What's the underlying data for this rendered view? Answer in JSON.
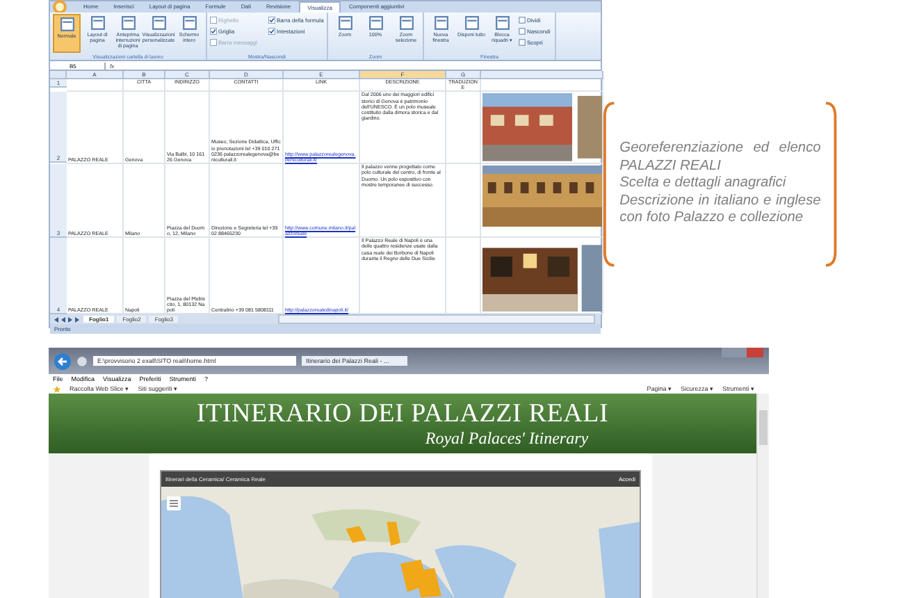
{
  "excel": {
    "tabs": [
      {
        "label": "Home",
        "selected": false
      },
      {
        "label": "Inserisci",
        "selected": false
      },
      {
        "label": "Layout di pagina",
        "selected": false
      },
      {
        "label": "Formule",
        "selected": false
      },
      {
        "label": "Dati",
        "selected": false
      },
      {
        "label": "Revisione",
        "selected": false
      },
      {
        "label": "Visualizza",
        "selected": true
      },
      {
        "label": "Componenti aggiuntivi",
        "selected": false
      }
    ],
    "ribbon_groups": [
      {
        "label": "Visualizzazioni cartella di lavoro",
        "items": [
          {
            "kind": "button",
            "label": "Normale",
            "selected": true
          },
          {
            "kind": "button",
            "label": "Layout di pagina",
            "selected": false
          },
          {
            "kind": "button",
            "label": "Anteprima interruzioni di pagina",
            "selected": false
          },
          {
            "kind": "button",
            "label": "Visualizzazioni personalizzate",
            "selected": false
          },
          {
            "kind": "button",
            "label": "Schermo intero",
            "selected": false
          }
        ]
      },
      {
        "label": "Mostra/Nascondi",
        "items": [
          {
            "kind": "check",
            "label": "Righello",
            "checked": false,
            "disabled": true
          },
          {
            "kind": "check",
            "label": "Griglia",
            "checked": true,
            "disabled": false
          },
          {
            "kind": "check",
            "label": "Barra messaggi",
            "checked": false,
            "disabled": true
          },
          {
            "kind": "check",
            "label": "Barra della formula",
            "checked": true,
            "disabled": false
          },
          {
            "kind": "check",
            "label": "Intestazioni",
            "checked": true,
            "disabled": false
          }
        ]
      },
      {
        "label": "Zoom",
        "items": [
          {
            "kind": "button",
            "label": "Zoom",
            "selected": false
          },
          {
            "kind": "button",
            "label": "100%",
            "selected": false
          },
          {
            "kind": "button",
            "label": "Zoom selezione",
            "selected": false
          }
        ]
      },
      {
        "label": "Finestra",
        "items": [
          {
            "kind": "button",
            "label": "Nuova finestra",
            "selected": false
          },
          {
            "kind": "button",
            "label": "Disponi tutto",
            "selected": false
          },
          {
            "kind": "button",
            "label": "Blocca riquadri ▾",
            "selected": false
          },
          {
            "kind": "small",
            "label": "Dividi"
          },
          {
            "kind": "small",
            "label": "Nascondi"
          },
          {
            "kind": "small",
            "label": "Scopri"
          }
        ]
      }
    ],
    "name_box": "B5",
    "formula_label": "fx",
    "columns": [
      {
        "label": "A",
        "selected": false
      },
      {
        "label": "B",
        "selected": false
      },
      {
        "label": "C",
        "selected": false
      },
      {
        "label": "D",
        "selected": false
      },
      {
        "label": "E",
        "selected": false
      },
      {
        "label": "F",
        "selected": true
      },
      {
        "label": "G",
        "selected": false
      }
    ],
    "header_row": {
      "number": "1",
      "cells": [
        "CITTA",
        "INDIRIZZO",
        "CONTATTI",
        "LINK",
        "DESCRIZIONE",
        "TRADUZIONE"
      ]
    },
    "rows": [
      {
        "number": "2",
        "name": "PALAZZO REALE",
        "city": "Genova",
        "address": "Via Balbi, 10 16126 Genova",
        "contacts": "Museo, Sezione Didattica, Ufficio prenotazioni tel +39 010 2710236 palazzorealegenova@beniculturali.it",
        "link": "http://www.palazzorealegenova.beniculturali.it/",
        "description": "Dal 2006 uno dei maggiori edifici storici di Genova è patrimonio dell'UNESCO. È un polo museale costituito dalla dimora storica e dal giardino."
      },
      {
        "number": "3",
        "name": "PALAZZO REALE",
        "city": "Milano",
        "address": "Piazza del Duomo, 12, Milano",
        "contacts": "Direzione e Segreteria tel +39 02 88465230",
        "link": "http://www.comune.milano.it/palazzoreale",
        "description": "Il palazzo venne progettato come polo culturale del centro, di fronte al Duomo. Un polo espositivo con mostre temporanee di successo."
      },
      {
        "number": "4",
        "name": "PALAZZO REALE",
        "city": "Napoli",
        "address": "Piazza del Plebiscito, 1, 80132 Napoli",
        "contacts": "Centralino +39 081 5808111",
        "link": "http://palazzorealedinapoli.it/",
        "description": "Il Palazzo Reale di Napoli è una delle quattro residenze usate dalla casa reale dei Borbone di Napoli durante il Regno delle Due Sicilie"
      }
    ],
    "sheet_tabs": [
      {
        "label": "Foglio1",
        "selected": true
      },
      {
        "label": "Foglio2",
        "selected": false
      },
      {
        "label": "Foglio3",
        "selected": false
      }
    ],
    "status": "Pronto"
  },
  "annotation": {
    "paragraphs": [
      "Georeferenziazione ed elenco PALAZZI REALI",
      "Scelta e dettagli anagrafici",
      "Descrizione in italiano e inglese con foto Palazzo e collezione"
    ]
  },
  "browser": {
    "address": "E:\\provvisorio 2 exall\\SITO reali\\home.html",
    "tab_title": "Itinerario dei Palazzi Reali - ...",
    "menu": [
      "File",
      "Modifica",
      "Visualizza",
      "Preferiti",
      "Strumenti",
      "?"
    ],
    "favorites": [
      "Raccolta Web Slice ▾",
      "Siti suggeriti ▾"
    ],
    "commands": [
      "Pagina ▾",
      "Sicurezza ▾",
      "Strumenti ▾"
    ],
    "banner_title": "ITINERARIO DEI PALAZZI REALI",
    "banner_subtitle": "Royal Palaces' Itinerary",
    "map": {
      "title": "Itinerari della Ceramica/ Ceramica Reale",
      "sign_in": "Accedi"
    }
  }
}
